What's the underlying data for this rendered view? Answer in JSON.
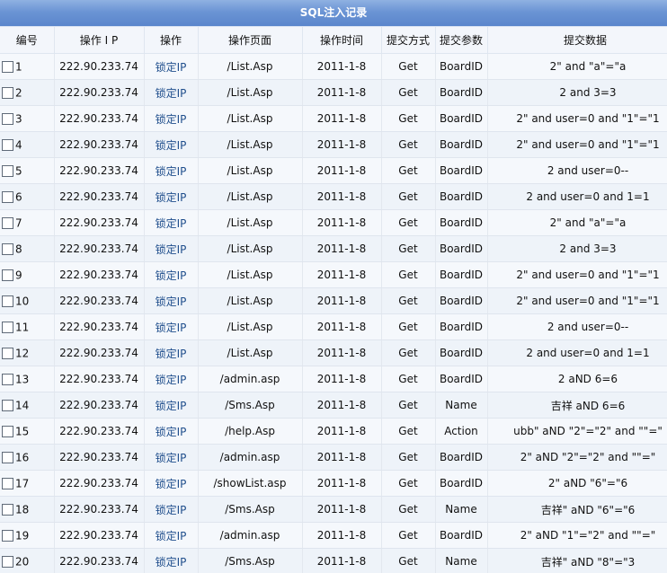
{
  "title": "SQL注入记录",
  "headers": [
    "编号",
    "操作 I P",
    "操作",
    "操作页面",
    "操作时间",
    "提交方式",
    "提交参数",
    "提交数据"
  ],
  "rows": [
    {
      "id": "1",
      "ip": "222.90.233.74",
      "action": "锁定IP",
      "page": "/List.Asp",
      "time": "2011-1-8",
      "method": "Get",
      "param": "BoardID",
      "data": "2\" and \"a\"=\"a"
    },
    {
      "id": "2",
      "ip": "222.90.233.74",
      "action": "锁定IP",
      "page": "/List.Asp",
      "time": "2011-1-8",
      "method": "Get",
      "param": "BoardID",
      "data": "2 and 3=3"
    },
    {
      "id": "3",
      "ip": "222.90.233.74",
      "action": "锁定IP",
      "page": "/List.Asp",
      "time": "2011-1-8",
      "method": "Get",
      "param": "BoardID",
      "data": "2\" and user=0 and \"1\"=\"1"
    },
    {
      "id": "4",
      "ip": "222.90.233.74",
      "action": "锁定IP",
      "page": "/List.Asp",
      "time": "2011-1-8",
      "method": "Get",
      "param": "BoardID",
      "data": "2\" and user=0 and \"1\"=\"1"
    },
    {
      "id": "5",
      "ip": "222.90.233.74",
      "action": "锁定IP",
      "page": "/List.Asp",
      "time": "2011-1-8",
      "method": "Get",
      "param": "BoardID",
      "data": "2 and user=0--"
    },
    {
      "id": "6",
      "ip": "222.90.233.74",
      "action": "锁定IP",
      "page": "/List.Asp",
      "time": "2011-1-8",
      "method": "Get",
      "param": "BoardID",
      "data": "2 and user=0 and 1=1"
    },
    {
      "id": "7",
      "ip": "222.90.233.74",
      "action": "锁定IP",
      "page": "/List.Asp",
      "time": "2011-1-8",
      "method": "Get",
      "param": "BoardID",
      "data": "2\" and \"a\"=\"a"
    },
    {
      "id": "8",
      "ip": "222.90.233.74",
      "action": "锁定IP",
      "page": "/List.Asp",
      "time": "2011-1-8",
      "method": "Get",
      "param": "BoardID",
      "data": "2 and 3=3"
    },
    {
      "id": "9",
      "ip": "222.90.233.74",
      "action": "锁定IP",
      "page": "/List.Asp",
      "time": "2011-1-8",
      "method": "Get",
      "param": "BoardID",
      "data": "2\" and user=0 and \"1\"=\"1"
    },
    {
      "id": "10",
      "ip": "222.90.233.74",
      "action": "锁定IP",
      "page": "/List.Asp",
      "time": "2011-1-8",
      "method": "Get",
      "param": "BoardID",
      "data": "2\" and user=0 and \"1\"=\"1"
    },
    {
      "id": "11",
      "ip": "222.90.233.74",
      "action": "锁定IP",
      "page": "/List.Asp",
      "time": "2011-1-8",
      "method": "Get",
      "param": "BoardID",
      "data": "2 and user=0--"
    },
    {
      "id": "12",
      "ip": "222.90.233.74",
      "action": "锁定IP",
      "page": "/List.Asp",
      "time": "2011-1-8",
      "method": "Get",
      "param": "BoardID",
      "data": "2 and user=0 and 1=1"
    },
    {
      "id": "13",
      "ip": "222.90.233.74",
      "action": "锁定IP",
      "page": "/admin.asp",
      "time": "2011-1-8",
      "method": "Get",
      "param": "BoardID",
      "data": "2 aND 6=6"
    },
    {
      "id": "14",
      "ip": "222.90.233.74",
      "action": "锁定IP",
      "page": "/Sms.Asp",
      "time": "2011-1-8",
      "method": "Get",
      "param": "Name",
      "data": "吉祥 aND 6=6"
    },
    {
      "id": "15",
      "ip": "222.90.233.74",
      "action": "锁定IP",
      "page": "/help.Asp",
      "time": "2011-1-8",
      "method": "Get",
      "param": "Action",
      "data": "ubb\" aND \"2\"=\"2\" and \"\"=\""
    },
    {
      "id": "16",
      "ip": "222.90.233.74",
      "action": "锁定IP",
      "page": "/admin.asp",
      "time": "2011-1-8",
      "method": "Get",
      "param": "BoardID",
      "data": "2\" aND \"2\"=\"2\" and \"\"=\""
    },
    {
      "id": "17",
      "ip": "222.90.233.74",
      "action": "锁定IP",
      "page": "/showList.asp",
      "time": "2011-1-8",
      "method": "Get",
      "param": "BoardID",
      "data": "2\" aND \"6\"=\"6"
    },
    {
      "id": "18",
      "ip": "222.90.233.74",
      "action": "锁定IP",
      "page": "/Sms.Asp",
      "time": "2011-1-8",
      "method": "Get",
      "param": "Name",
      "data": "吉祥\" aND \"6\"=\"6"
    },
    {
      "id": "19",
      "ip": "222.90.233.74",
      "action": "锁定IP",
      "page": "/admin.asp",
      "time": "2011-1-8",
      "method": "Get",
      "param": "BoardID",
      "data": "2\" aND \"1\"=\"2\" and \"\"=\""
    },
    {
      "id": "20",
      "ip": "222.90.233.74",
      "action": "锁定IP",
      "page": "/Sms.Asp",
      "time": "2011-1-8",
      "method": "Get",
      "param": "Name",
      "data": "吉祥\" aND \"8\"=\"3"
    }
  ]
}
